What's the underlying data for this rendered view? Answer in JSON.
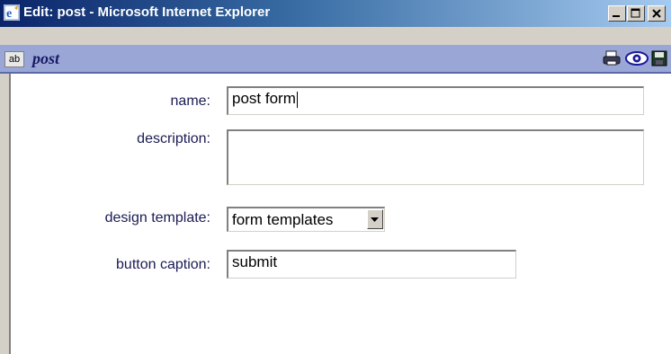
{
  "window": {
    "title": "Edit: post - Microsoft Internet Explorer",
    "title_color": "#ffffff",
    "titlebar_colors": [
      "#0a246a",
      "#a6caf0"
    ]
  },
  "toolbar": {
    "ab_label": "ab",
    "doc_title": "post",
    "icons": [
      "print-icon",
      "preview-eye-icon",
      "save-disk-icon"
    ]
  },
  "form": {
    "name_label": "name:",
    "name_value": "post form",
    "description_label": "description:",
    "description_value": "",
    "design_template_label": "design template:",
    "design_template_value": "form templates",
    "button_caption_label": "button caption:",
    "button_caption_value": "submit"
  }
}
